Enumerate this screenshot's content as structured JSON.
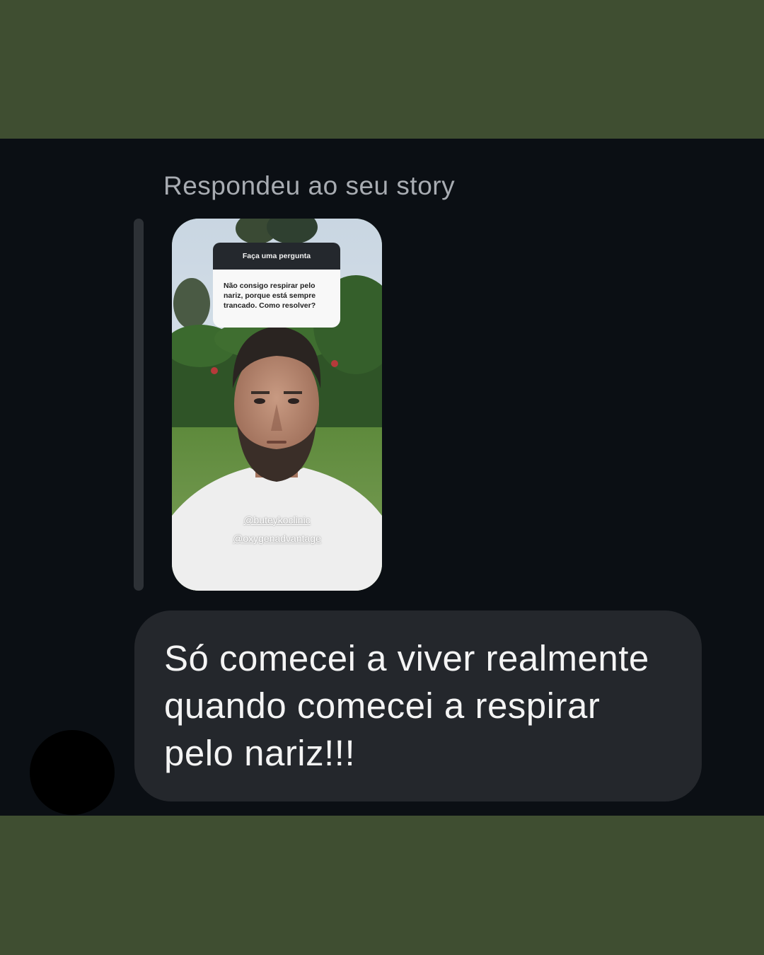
{
  "conversation": {
    "reply_label": "Respondeu ao seu story",
    "story": {
      "question_header": "Faça uma pergunta",
      "question_text": "Não consigo respirar pelo nariz, porque está sempre trancado. Como resolver?",
      "mentions": [
        "@buteykoclinic",
        "@oxygenadvantage"
      ]
    },
    "message": {
      "text": "Só comecei a viver realmente quando comecei a respirar pelo nariz!!!"
    }
  },
  "colors": {
    "frame_background": "#3f4e31",
    "chat_background": "#0b0f14",
    "bubble_background": "#24272c",
    "reply_label_color": "#a8acb2"
  }
}
